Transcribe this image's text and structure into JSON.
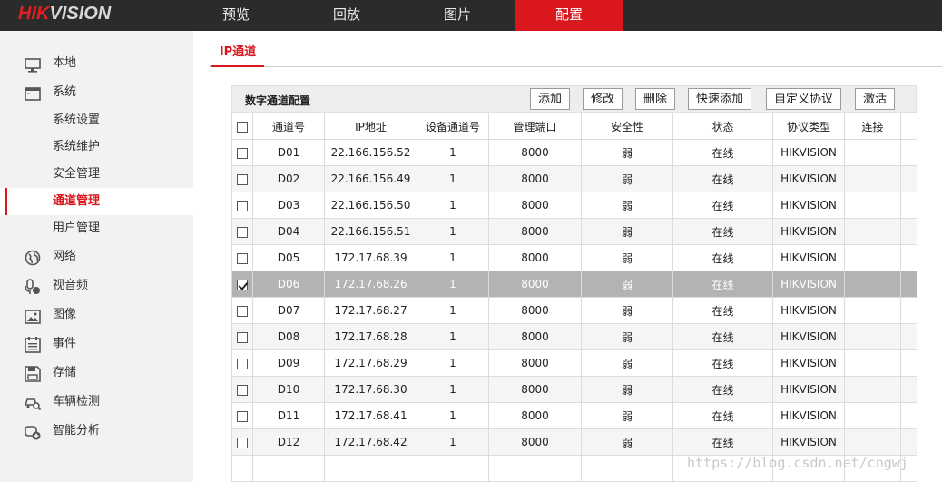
{
  "brand": {
    "logo_red": "HIK",
    "logo_gray": "VISION"
  },
  "nav": {
    "tabs": [
      {
        "label": "预览"
      },
      {
        "label": "回放"
      },
      {
        "label": "图片"
      },
      {
        "label": "配置",
        "active": true
      }
    ]
  },
  "sidebar": {
    "items": [
      {
        "label": "本地",
        "icon": "monitor-icon"
      },
      {
        "label": "系统",
        "icon": "window-icon"
      },
      {
        "label": "系统设置",
        "sub": true
      },
      {
        "label": "系统维护",
        "sub": true
      },
      {
        "label": "安全管理",
        "sub": true
      },
      {
        "label": "通道管理",
        "sub": true,
        "active": true
      },
      {
        "label": "用户管理",
        "sub": true
      },
      {
        "label": "网络",
        "icon": "globe-icon"
      },
      {
        "label": "视音频",
        "icon": "microphone-icon"
      },
      {
        "label": "图像",
        "icon": "image-icon"
      },
      {
        "label": "事件",
        "icon": "list-icon"
      },
      {
        "label": "存储",
        "icon": "disk-icon"
      },
      {
        "label": "车辆检测",
        "icon": "car-search-icon"
      },
      {
        "label": "智能分析",
        "icon": "smart-analysis-icon"
      }
    ]
  },
  "subtab": {
    "label": "IP通道"
  },
  "panel": {
    "title": "数字通道配置",
    "buttons": {
      "add": "添加",
      "modify": "修改",
      "delete": "删除",
      "quick_add": "快速添加",
      "custom_protocol": "自定义协议",
      "activate": "激活"
    }
  },
  "table": {
    "headers": [
      "通道号",
      "IP地址",
      "设备通道号",
      "管理端口",
      "安全性",
      "状态",
      "协议类型",
      "连接"
    ],
    "rows": [
      {
        "ch": "D01",
        "ip": "22.166.156.52",
        "devch": "1",
        "port": "8000",
        "sec": "弱",
        "status": "在线",
        "proto": "HIKVISION",
        "checked": false
      },
      {
        "ch": "D02",
        "ip": "22.166.156.49",
        "devch": "1",
        "port": "8000",
        "sec": "弱",
        "status": "在线",
        "proto": "HIKVISION",
        "checked": false
      },
      {
        "ch": "D03",
        "ip": "22.166.156.50",
        "devch": "1",
        "port": "8000",
        "sec": "弱",
        "status": "在线",
        "proto": "HIKVISION",
        "checked": false
      },
      {
        "ch": "D04",
        "ip": "22.166.156.51",
        "devch": "1",
        "port": "8000",
        "sec": "弱",
        "status": "在线",
        "proto": "HIKVISION",
        "checked": false
      },
      {
        "ch": "D05",
        "ip": "172.17.68.39",
        "devch": "1",
        "port": "8000",
        "sec": "弱",
        "status": "在线",
        "proto": "HIKVISION",
        "checked": false
      },
      {
        "ch": "D06",
        "ip": "172.17.68.26",
        "devch": "1",
        "port": "8000",
        "sec": "弱",
        "status": "在线",
        "proto": "HIKVISION",
        "checked": true
      },
      {
        "ch": "D07",
        "ip": "172.17.68.27",
        "devch": "1",
        "port": "8000",
        "sec": "弱",
        "status": "在线",
        "proto": "HIKVISION",
        "checked": false
      },
      {
        "ch": "D08",
        "ip": "172.17.68.28",
        "devch": "1",
        "port": "8000",
        "sec": "弱",
        "status": "在线",
        "proto": "HIKVISION",
        "checked": false
      },
      {
        "ch": "D09",
        "ip": "172.17.68.29",
        "devch": "1",
        "port": "8000",
        "sec": "弱",
        "status": "在线",
        "proto": "HIKVISION",
        "checked": false
      },
      {
        "ch": "D10",
        "ip": "172.17.68.30",
        "devch": "1",
        "port": "8000",
        "sec": "弱",
        "status": "在线",
        "proto": "HIKVISION",
        "checked": false
      },
      {
        "ch": "D11",
        "ip": "172.17.68.41",
        "devch": "1",
        "port": "8000",
        "sec": "弱",
        "status": "在线",
        "proto": "HIKVISION",
        "checked": false
      },
      {
        "ch": "D12",
        "ip": "172.17.68.42",
        "devch": "1",
        "port": "8000",
        "sec": "弱",
        "status": "在线",
        "proto": "HIKVISION",
        "checked": false
      }
    ]
  },
  "watermark": "https://blog.csdn.net/cngwj",
  "colors": {
    "accent": "#d9171d",
    "topbar": "#2b2b2b",
    "sidebar": "#f2f2f2",
    "selected_row": "#b3b3b3"
  }
}
